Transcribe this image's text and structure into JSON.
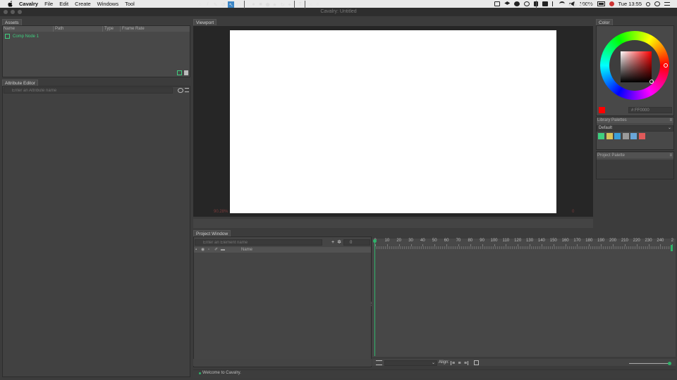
{
  "menubar": {
    "app_name": "Cavalry",
    "items": [
      "File",
      "Edit",
      "Create",
      "Windows",
      "Tool"
    ],
    "battery": "100%",
    "clock": "Tue 13:55"
  },
  "window": {
    "title": "Cavalry: Untitled"
  },
  "assets": {
    "tab": "Assets",
    "columns": [
      "Name",
      "Path",
      "Type",
      "Frame Rate"
    ],
    "rows": [
      {
        "name": "Comp Node 1"
      }
    ]
  },
  "attribute_editor": {
    "tab": "Attribute Editor",
    "search_placeholder": "Enter an Attribute name"
  },
  "viewport": {
    "tab": "Viewport",
    "zoom_readout": "90.28%",
    "frame_readout": "0"
  },
  "project_window": {
    "tab": "Project Window",
    "search_placeholder": "Enter an Element name",
    "frame_field": "0",
    "name_column": "Name"
  },
  "timeline": {
    "ticks": [
      "0",
      "10",
      "20",
      "30",
      "40",
      "50",
      "60",
      "70",
      "80",
      "90",
      "100",
      "110",
      "120",
      "130",
      "140",
      "150",
      "160",
      "170",
      "180",
      "190",
      "200",
      "210",
      "220",
      "230",
      "240",
      "2"
    ],
    "align_label": "Align:",
    "dropdown_value": ""
  },
  "color": {
    "tab": "Color",
    "hex_value": "FF0000",
    "hex_prefix": "#",
    "current_color": "#ff0000"
  },
  "library_palettes": {
    "tab": "Library Palettes",
    "selected": "Default",
    "swatches": [
      "#3fcf7f",
      "#d8c25a",
      "#3a9fd8",
      "#9a9a9a",
      "#6aa6d8",
      "#e05a5a"
    ]
  },
  "project_palette": {
    "tab": "Project Palette"
  },
  "status": {
    "message": "Welcome to Cavalry."
  },
  "accent_colors": {
    "selection": "#3c86c6",
    "playhead": "#2fb36a",
    "asset_text": "#3fcf7f"
  }
}
